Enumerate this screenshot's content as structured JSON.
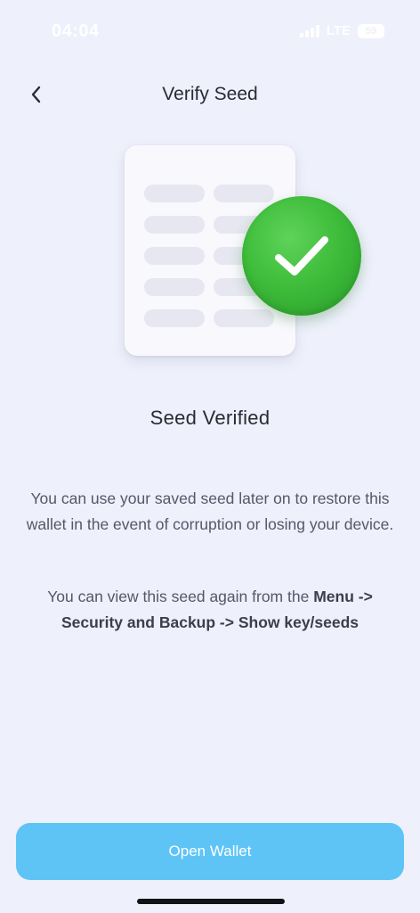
{
  "status_bar": {
    "time": "04:04",
    "network": "LTE",
    "battery": "59"
  },
  "header": {
    "title": "Verify Seed",
    "back_icon": "chevron-left-icon"
  },
  "illustration": {
    "doc_icon": "seed-document-icon",
    "check_icon": "check-icon",
    "check_color": "#3fbd3b"
  },
  "main": {
    "headline": "Seed Verified",
    "paragraph1": "You can use your saved seed later on to restore this wallet in the event of corruption or losing your device.",
    "paragraph2_prefix": "You can view this seed again from the ",
    "paragraph2_path_line1": "Menu ->",
    "paragraph2_path_line2": "Security and Backup -> Show key/seeds"
  },
  "footer": {
    "open_wallet_label": "Open Wallet",
    "button_color": "#5ec4f6"
  }
}
